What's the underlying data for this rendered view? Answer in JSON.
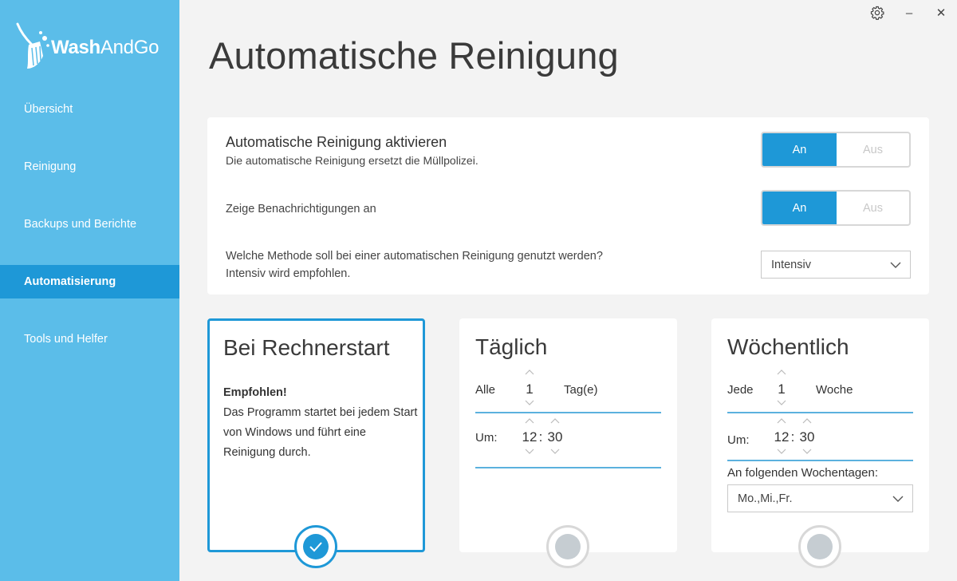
{
  "app": {
    "logo_text_bold": "Wash",
    "logo_text": "AndGo"
  },
  "window": {
    "settings_icon": "gear-icon",
    "minimize_label": "–",
    "close_label": "✕"
  },
  "sidebar": {
    "items": [
      {
        "label": "Übersicht",
        "active": false
      },
      {
        "label": "Reinigung",
        "active": false
      },
      {
        "label": "Backups und Berichte",
        "active": false
      },
      {
        "label": "Automatisierung",
        "active": true
      },
      {
        "label": "Tools und Helfer",
        "active": false
      }
    ]
  },
  "page": {
    "title": "Automatische Reinigung"
  },
  "settings": {
    "auto": {
      "title": "Automatische Reinigung aktivieren",
      "subtitle": "Die automatische Reinigung ersetzt die Müllpolizei.",
      "on": "An",
      "off": "Aus"
    },
    "notify": {
      "label": "Zeige Benachrichtigungen an",
      "on": "An",
      "off": "Aus"
    },
    "method": {
      "line1": "Welche Methode soll bei einer automatischen Reinigung genutzt werden?",
      "line2": "Intensiv wird empfohlen.",
      "value": "Intensiv"
    }
  },
  "schedules": {
    "startup": {
      "title": "Bei Rechnerstart",
      "bold": "Empfohlen!",
      "text": "Das Programm startet bei jedem Start von Windows und führt eine Reinigung durch.",
      "selected": true
    },
    "daily": {
      "title": "Täglich",
      "every_label": "Alle",
      "every_value": "1",
      "unit": "Tag(e)",
      "at_label": "Um:",
      "hour": "12",
      "sep": ":",
      "minute": "30",
      "selected": false
    },
    "weekly": {
      "title": "Wöchentlich",
      "every_label": "Jede",
      "every_value": "1",
      "unit": "Woche",
      "at_label": "Um:",
      "hour": "12",
      "sep": ":",
      "minute": "30",
      "days_label": "An folgenden Wochentagen:",
      "days_value": "Mo.,Mi.,Fr.",
      "selected": false
    }
  },
  "colors": {
    "sidebar": "#5bbde9",
    "accent": "#1e98d7"
  }
}
